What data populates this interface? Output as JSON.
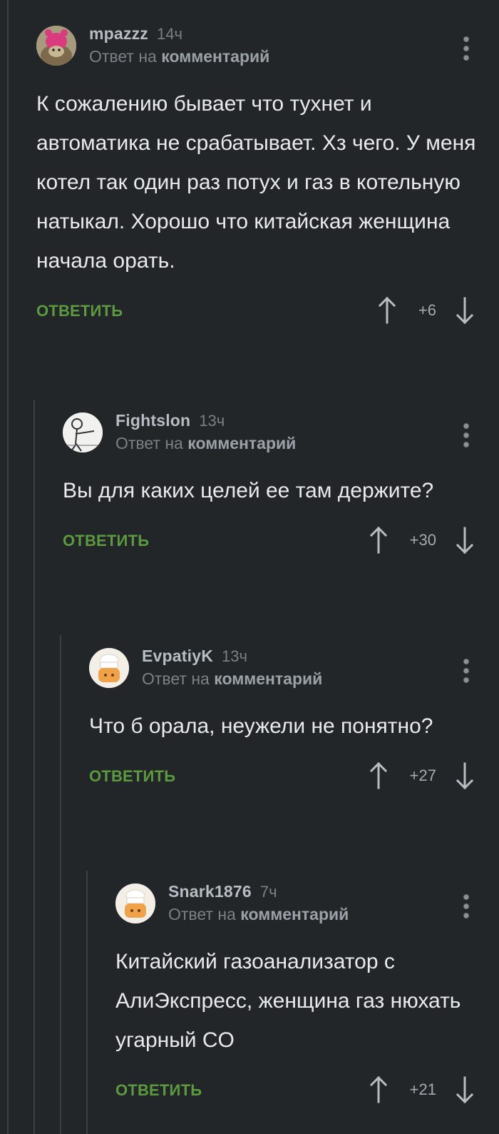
{
  "reply_prefix": "Ответ на",
  "comments": [
    {
      "author": "mpazzz",
      "time": "14ч",
      "reply_to": "комментарий",
      "text": "К сожалению бывает что тухнет и автоматика не срабатывает. Хз чего. У меня котел так один раз потух и газ в котельную натыкал. Хорошо что китайская женщина начала орать.",
      "reply_label": "ОТВЕТИТЬ",
      "rating": "+6",
      "avatar_icon": "hedgehog-avatar"
    },
    {
      "author": "Fightslon",
      "time": "13ч",
      "reply_to": "комментарий",
      "text": "Вы для каких целей ее там держите?",
      "reply_label": "ОТВЕТИТЬ",
      "rating": "+30",
      "avatar_icon": "sketch-man-avatar"
    },
    {
      "author": "EvpatiyK",
      "time": "13ч",
      "reply_to": "комментарий",
      "text": "Что б орала, неужели не понятно?",
      "reply_label": "ОТВЕТИТЬ",
      "rating": "+27",
      "avatar_icon": "default-chef-avatar"
    },
    {
      "author": "Snark1876",
      "time": "7ч",
      "reply_to": "комментарий",
      "text": "Китайский газоанализатор с АлиЭкспресс, женщина газ нюхать угарный CO",
      "reply_label": "ОТВЕТИТЬ",
      "rating": "+21",
      "avatar_icon": "default-chef-avatar"
    }
  ],
  "colors": {
    "background": "#232629",
    "reply_accent": "#5b9a3e",
    "author": "#b6bdc3",
    "text": "#e9eaec"
  }
}
